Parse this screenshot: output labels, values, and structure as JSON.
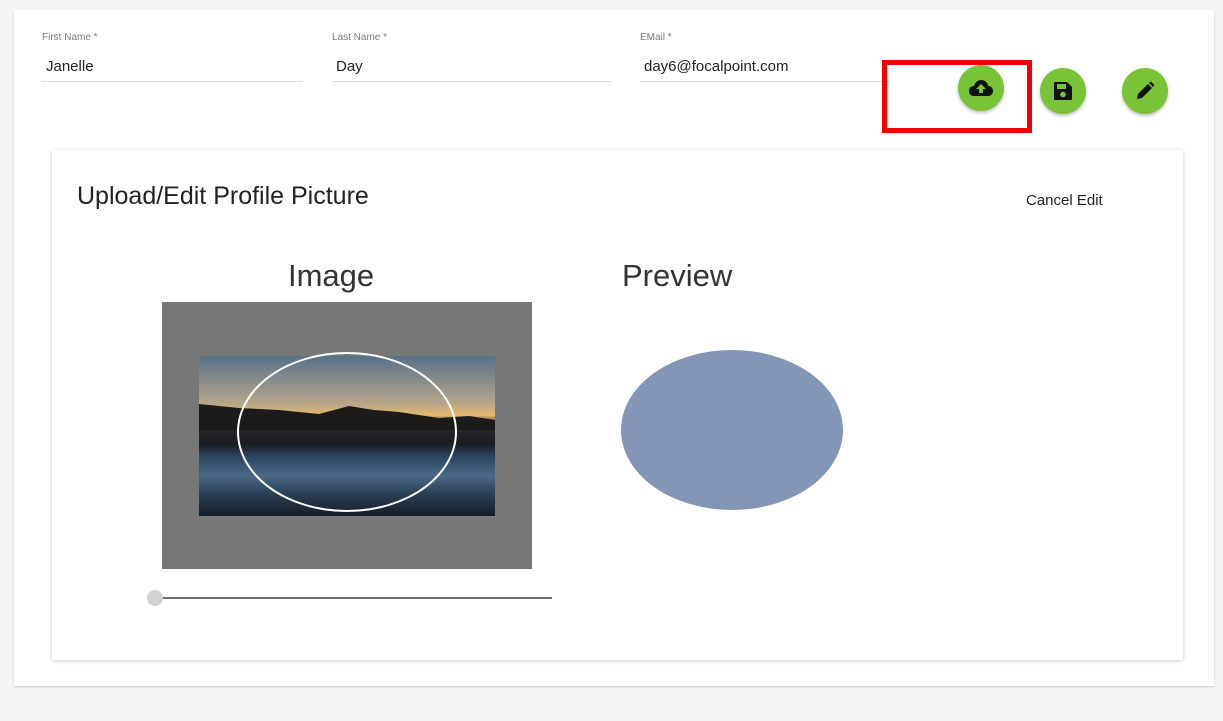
{
  "form": {
    "first_name": {
      "label": "First Name *",
      "value": "Janelle"
    },
    "last_name": {
      "label": "Last Name *",
      "value": "Day"
    },
    "email": {
      "label": "EMail *",
      "value": "day6@focalpoint.com"
    }
  },
  "actions": {
    "upload_icon": "cloud-upload-icon",
    "save_icon": "save-icon",
    "edit_icon": "pencil-icon",
    "button_color": "#79c337",
    "highlight_color": "#f20000"
  },
  "editor": {
    "title": "Upload/Edit Profile Picture",
    "cancel_label": "Cancel Edit",
    "image_heading": "Image",
    "preview_heading": "Preview",
    "zoom_level": 0
  }
}
